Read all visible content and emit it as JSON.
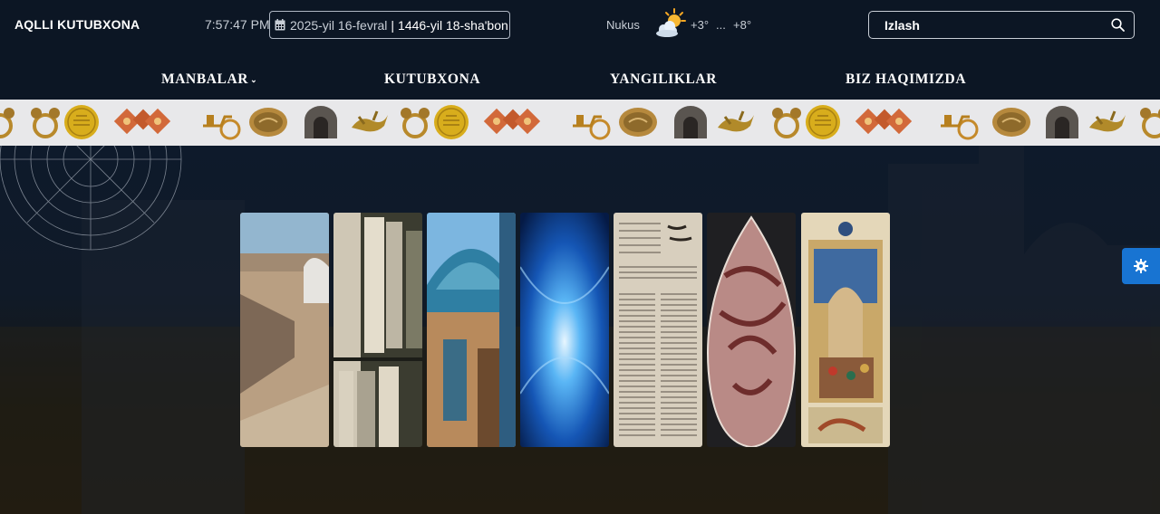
{
  "header": {
    "brand": "AQLLI KUTUBXONA",
    "time": "7:57:47 PM",
    "date_gregorian": "2025-yil 16-fevral",
    "date_separator": "|",
    "date_hijri": "1446-yil 18-sha'bon",
    "weather": {
      "city": "Nukus",
      "icon": "partly-cloudy-sun-icon",
      "temp_min": "+3°",
      "temp_dots": "...",
      "temp_max": "+8°"
    },
    "search": {
      "value": "",
      "placeholder": "Izlash",
      "icon": "search-icon"
    }
  },
  "nav": {
    "items": [
      {
        "label": "MANBALAR",
        "has_dropdown": true,
        "caret": "⌄"
      },
      {
        "label": "KUTUBXONA"
      },
      {
        "label": "YANGILIKLAR"
      },
      {
        "label": "BIZ HAQIMIZDA"
      }
    ]
  },
  "artifact_strip": {
    "items": [
      "ring-ornament-icon",
      "gold-coin-icon",
      "copper-ornament-icon",
      "chariot-figurine-icon",
      "bronze-plaque-icon",
      "stone-arch-icon",
      "winged-beast-icon"
    ]
  },
  "gallery": {
    "panels": [
      "desert-ruins",
      "library-shelves",
      "tiled-mausoleum-dome",
      "blue-light-tunnel",
      "old-newspaper",
      "calligraphy-tile",
      "persian-miniature"
    ]
  },
  "settings": {
    "icon": "gear-icon"
  },
  "colors": {
    "background": "#0c1624",
    "strip_background": "#e8e8ea",
    "settings_button": "#1874d2",
    "text": "#ffffff",
    "muted_text": "#c8ced6"
  }
}
